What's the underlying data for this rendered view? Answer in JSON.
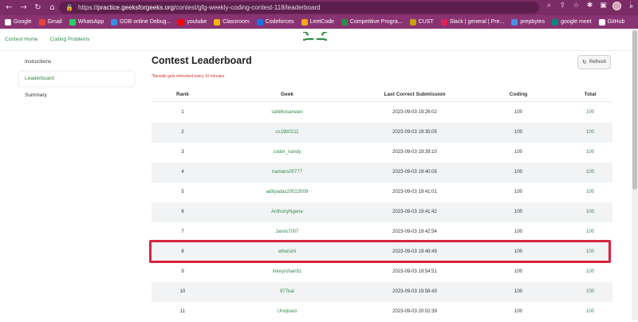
{
  "browser": {
    "url_prefix": "https://",
    "url_host": "practice.geeksforgeeks.org",
    "url_path": "/contest/gfg-weekly-coding-contest-118/leaderboard",
    "nav": {
      "back": "←",
      "forward": "→",
      "reload": "↻",
      "home": "⌂"
    },
    "right_icons": [
      "⌕",
      "⇪",
      "☆",
      "✱",
      "▣",
      "⋮"
    ]
  },
  "bookmarks": [
    {
      "label": "Google",
      "color": "#ffffff"
    },
    {
      "label": "Gmail",
      "color": "#ea4335"
    },
    {
      "label": "WhatsApp",
      "color": "#25d366"
    },
    {
      "label": "GDB online Debug...",
      "color": "#3a8ee6"
    },
    {
      "label": "youtube",
      "color": "#ff0000"
    },
    {
      "label": "Classroom",
      "color": "#f4b400"
    },
    {
      "label": "Codeforces",
      "color": "#1a73e8"
    },
    {
      "label": "LeetCode",
      "color": "#ffa116"
    },
    {
      "label": "Competitive Progra...",
      "color": "#2f8d46"
    },
    {
      "label": "CUST",
      "color": "#c8a200"
    },
    {
      "label": "Slack | general | Pre...",
      "color": "#e01e5a"
    },
    {
      "label": "prepbytes",
      "color": "#4a90e2"
    },
    {
      "label": "google meet",
      "color": "#00897b"
    },
    {
      "label": "GitHub",
      "color": "#ffffff"
    }
  ],
  "bookmarks_more": "»",
  "site_nav": {
    "contest_home": "Contest Home",
    "coding_problems": "Coding Problems"
  },
  "sidebar": {
    "items": [
      "Instructions",
      "Leaderboard",
      "Summary"
    ],
    "active": "Leaderboard"
  },
  "main": {
    "title": "Contest Leaderboard",
    "note": "*Results gets refreshed every 10 minutes",
    "refresh_label": "Refresh",
    "columns": [
      "Rank",
      "Geek",
      "Last Correct Submission",
      "Coding",
      "Total"
    ],
    "rows": [
      [
        "1",
        "sahilkosarwani",
        "2023-09-03 19:26:02",
        "100",
        "100"
      ],
      [
        "2",
        "cs19b0211",
        "2023-09-03 19:35:05",
        "100",
        "100"
      ],
      [
        "3",
        "coder_nandy",
        "2023-09-03 19:39:10",
        "100",
        "100"
      ],
      [
        "4",
        "namans00777",
        "2023-09-03 19:40:05",
        "100",
        "100"
      ],
      [
        "5",
        "adityadas20022009",
        "2023-09-03 19:41:01",
        "100",
        "100"
      ],
      [
        "6",
        "AnthonyNgene",
        "2023-09-03 19:41:42",
        "100",
        "100"
      ],
      [
        "7",
        "Jarvis7007",
        "2023-09-03 19:42:54",
        "100",
        "100"
      ],
      [
        "8",
        "whorishi",
        "2023-09-03 19:49:49",
        "100",
        "100"
      ],
      [
        "9",
        "lirkeyrohan91",
        "2023-09-03 19:54:51",
        "100",
        "100"
      ],
      [
        "10",
        "977kai",
        "2023-09-03 19:58:43",
        "100",
        "100"
      ],
      [
        "11",
        "Urvijivani",
        "2023-09-03 20:02:39",
        "100",
        "100"
      ]
    ],
    "highlighted_rank": "8"
  },
  "colors": {
    "brand_green": "#2f8d46",
    "chrome": "#7b2b66",
    "highlight": "#d8233f"
  }
}
